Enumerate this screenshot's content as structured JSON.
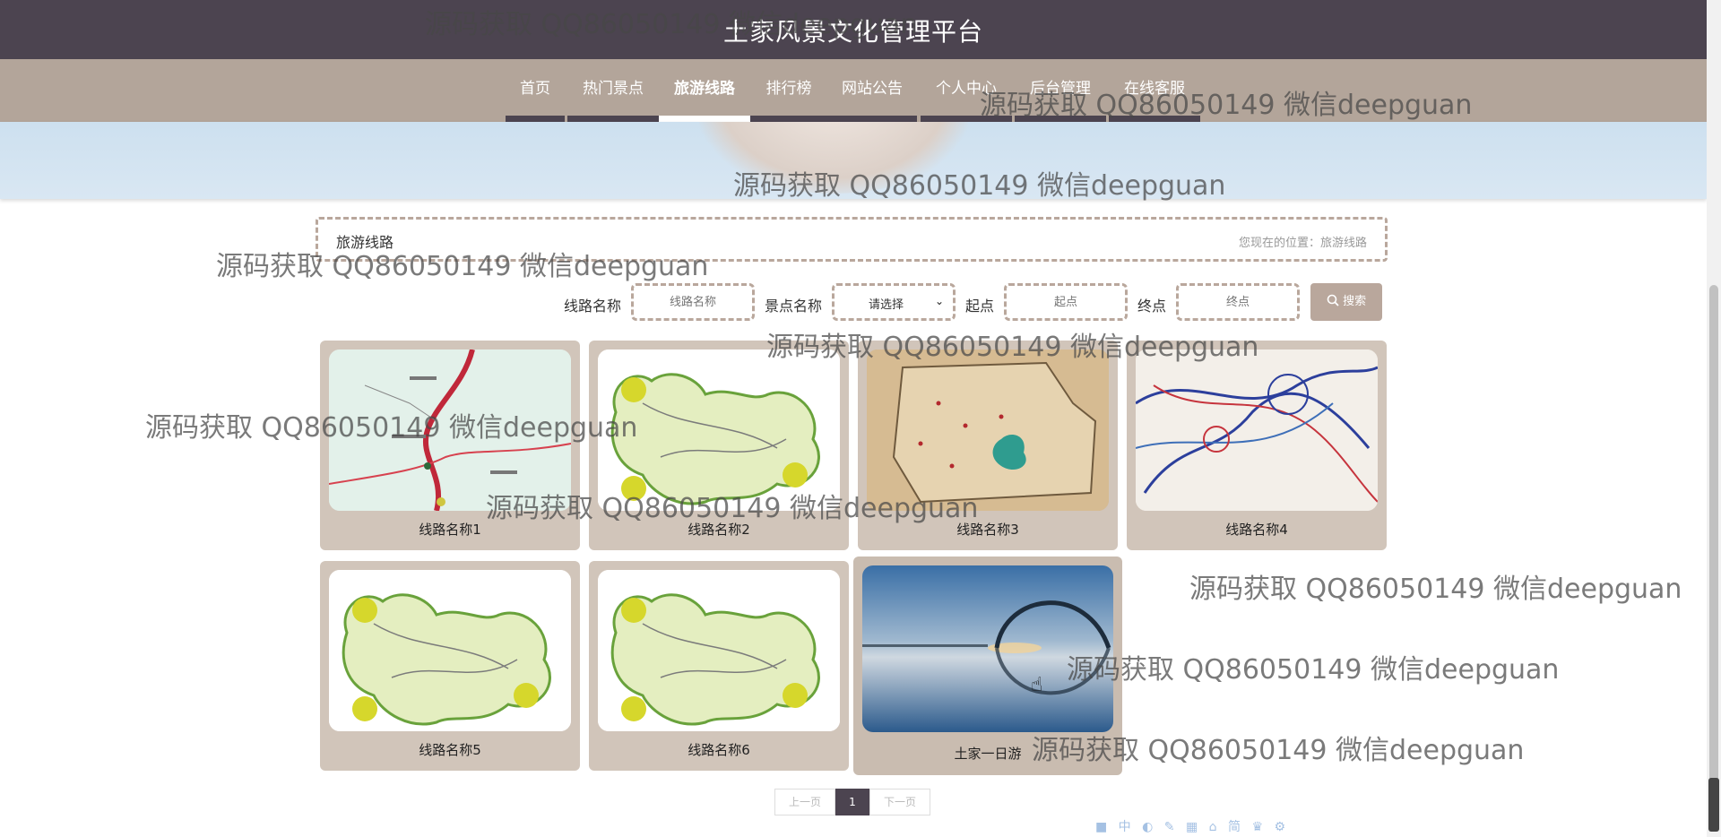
{
  "site": {
    "title": "土家风景文化管理平台"
  },
  "nav": {
    "items": [
      {
        "label": "首页"
      },
      {
        "label": "热门景点"
      },
      {
        "label": "旅游线路",
        "active": true
      },
      {
        "label": "排行榜"
      },
      {
        "label": "网站公告"
      },
      {
        "label": "个人中心"
      },
      {
        "label": "后台管理"
      },
      {
        "label": "在线客服"
      }
    ]
  },
  "breadcrumb": {
    "title": "旅游线路",
    "location": "您现在的位置：旅游线路"
  },
  "search": {
    "route_name_label": "线路名称",
    "route_name_placeholder": "线路名称",
    "scenic_label": "景点名称",
    "scenic_selected": "请选择",
    "start_label": "起点",
    "start_placeholder": "起点",
    "end_label": "终点",
    "end_placeholder": "终点",
    "button_label": "搜索",
    "button_icon": "search-icon"
  },
  "routes": [
    {
      "name": "线路名称1",
      "image": "map-road"
    },
    {
      "name": "线路名称2",
      "image": "map-green"
    },
    {
      "name": "线路名称3",
      "image": "map-parchment"
    },
    {
      "name": "线路名称4",
      "image": "map-lines"
    },
    {
      "name": "线路名称5",
      "image": "map-green"
    },
    {
      "name": "线路名称6",
      "image": "map-green"
    },
    {
      "name": "土家一日游",
      "image": "bridge-sunset"
    }
  ],
  "pagination": {
    "prev": "上一页",
    "current": "1",
    "next": "下一页"
  },
  "watermark_text": "源码获取 QQ86050149 微信deepguan",
  "colors": {
    "header": "#4c4450",
    "nav": "#b3a59a",
    "card": "#d1c5ba",
    "accent": "#b9a79c"
  }
}
